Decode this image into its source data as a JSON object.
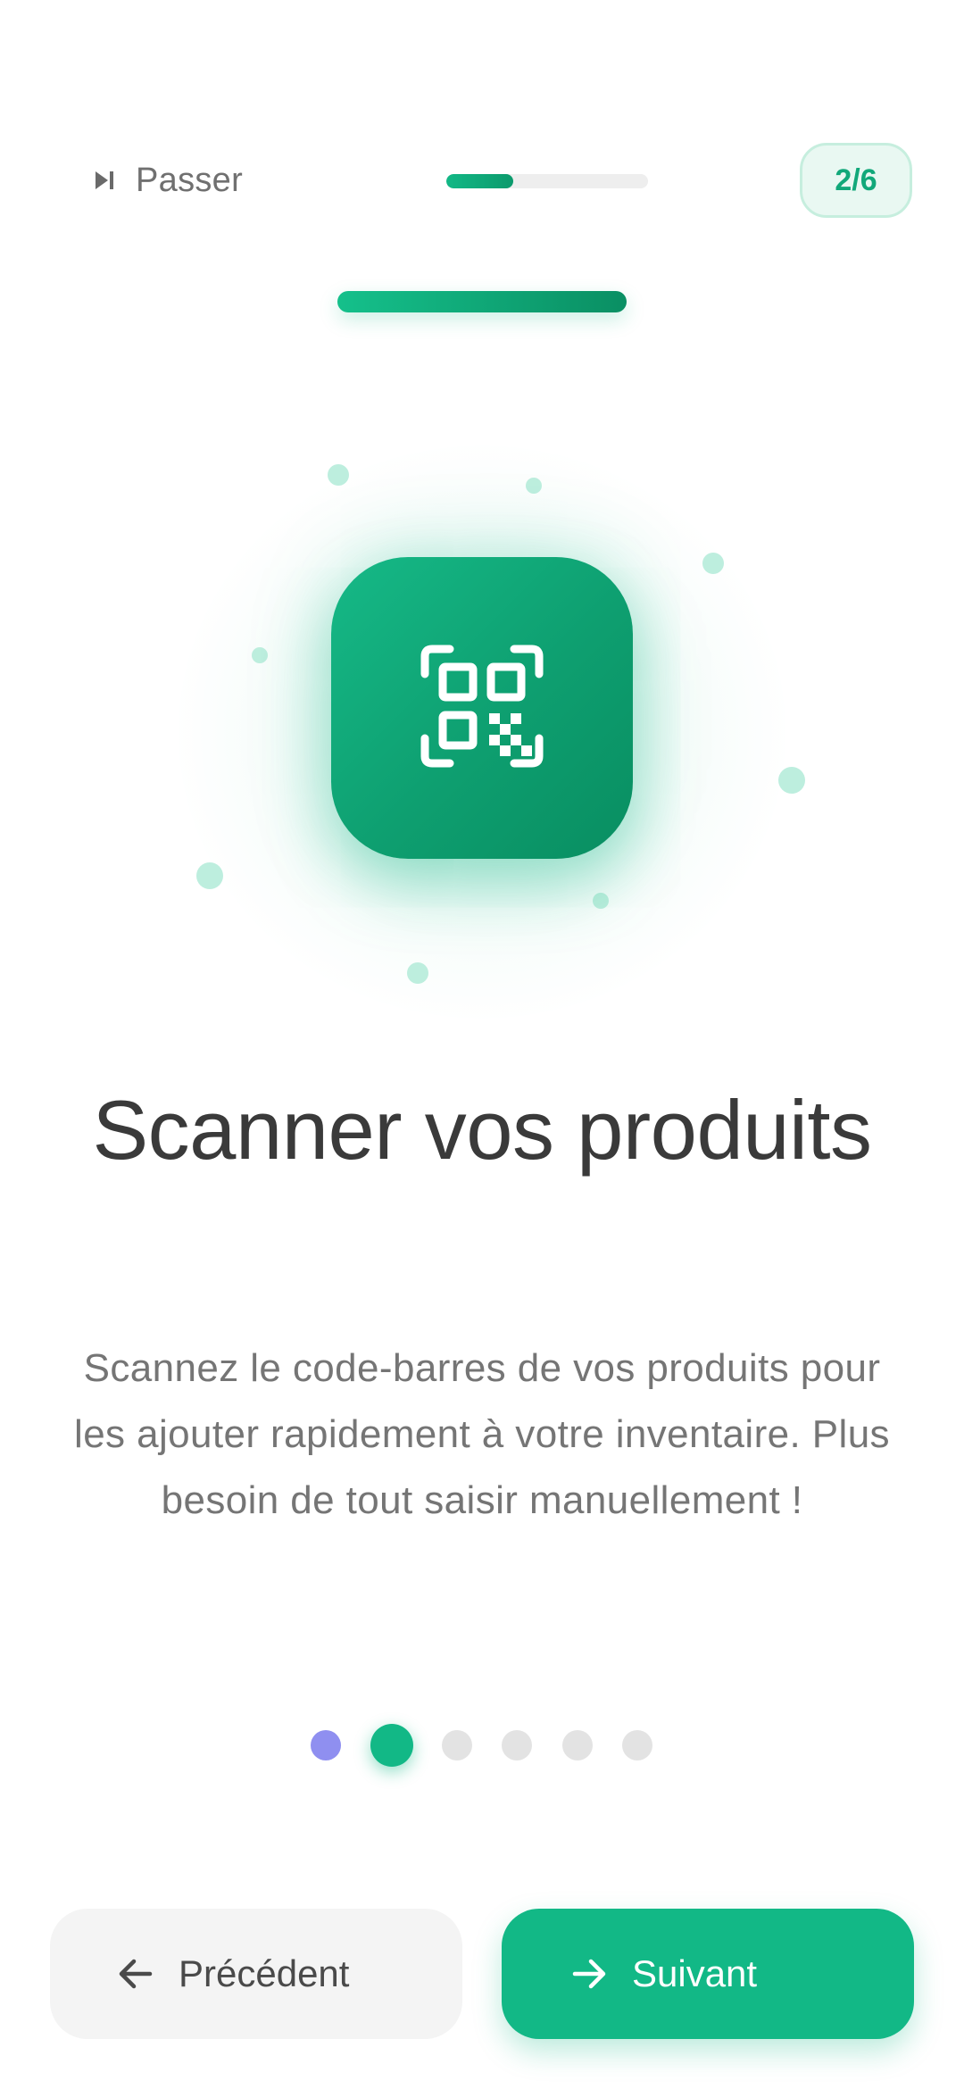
{
  "header": {
    "skip_label": "Passer",
    "skip_icon": "skip-forward-icon",
    "progress": 0.333,
    "step_label": "2/6"
  },
  "hero": {
    "icon": "qr-scan-icon"
  },
  "content": {
    "title": "Scanner vos produits",
    "description": "Scannez le code-barres de vos produits pour les ajouter rapidement à votre inventaire. Plus besoin de tout saisir manuellement !"
  },
  "pagination": {
    "total": 6,
    "current_index": 1,
    "visited_color": "#8f8ff0",
    "active_color": "#12b886",
    "inactive_color": "#e3e3e3"
  },
  "footer": {
    "previous_label": "Précédent",
    "previous_icon": "arrow-left-icon",
    "next_label": "Suivant",
    "next_icon": "arrow-right-icon"
  },
  "colors": {
    "accent": "#12b886",
    "accent_dark": "#0a8f63",
    "text_primary": "#3a3a3a",
    "text_secondary": "#757575"
  }
}
